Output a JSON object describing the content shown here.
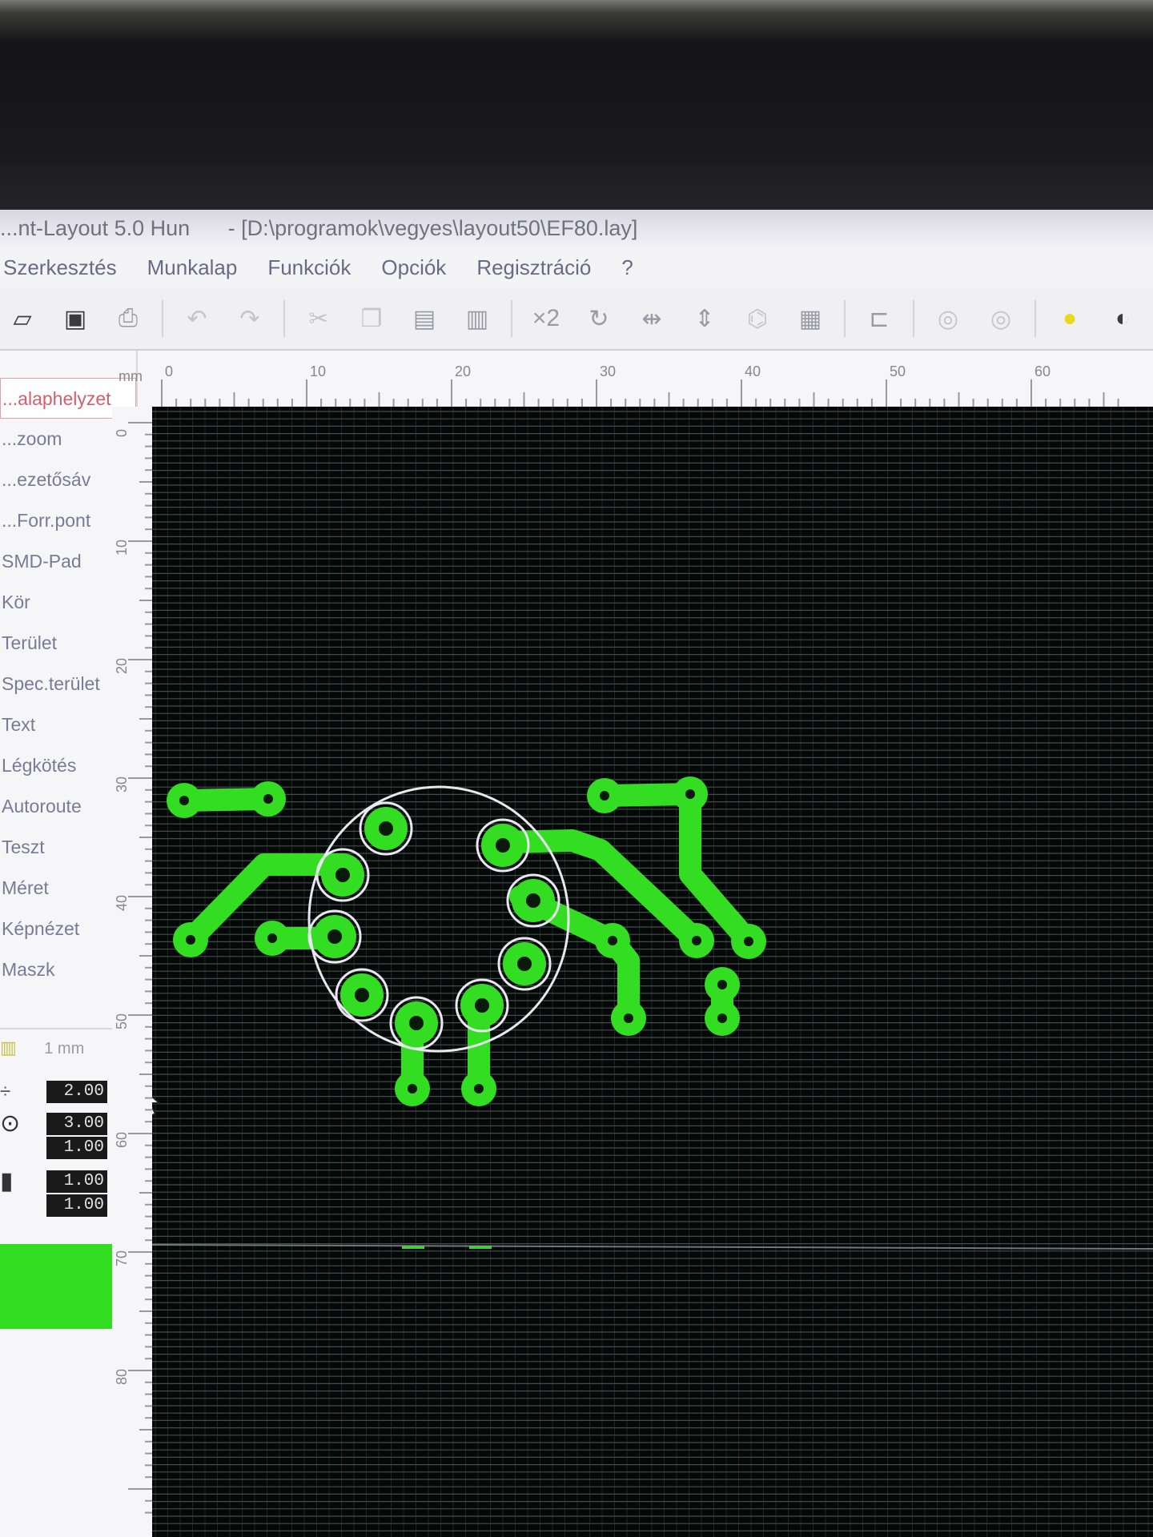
{
  "window": {
    "app_title": "...nt-Layout 5.0 Hun",
    "file_path": "- [D:\\programok\\vegyes\\layout50\\EF80.lay]"
  },
  "menu": [
    "Szerkesztés",
    "Munkalap",
    "Funkciók",
    "Opciók",
    "Regisztráció",
    "?"
  ],
  "toolbar": {
    "buttons": [
      {
        "icon": "open-folder-icon"
      },
      {
        "icon": "save-icon"
      },
      {
        "icon": "print-icon"
      },
      {
        "icon": "undo-icon"
      },
      {
        "icon": "redo-icon"
      },
      {
        "icon": "cut-icon"
      },
      {
        "icon": "copy-icon"
      },
      {
        "icon": "paste-icon"
      },
      {
        "icon": "delete-icon"
      },
      {
        "icon": "duplicate-x2-icon",
        "label": "×2"
      },
      {
        "icon": "rotate-icon"
      },
      {
        "icon": "mirror-horizontal-icon"
      },
      {
        "icon": "mirror-vertical-icon"
      },
      {
        "icon": "group-icon"
      },
      {
        "icon": "grid-icon"
      },
      {
        "icon": "connection-icon"
      },
      {
        "icon": "zoom-icon"
      }
    ]
  },
  "sidebar": {
    "items": [
      {
        "label": "...alaphelyzet",
        "icon": "cursor-icon",
        "active": true
      },
      {
        "label": "...zoom",
        "icon": "zoom-icon"
      },
      {
        "label": "...ezetősáv",
        "icon": "track-icon"
      },
      {
        "label": "...Forr.pont",
        "icon": "solder-pad-icon"
      },
      {
        "label": "SMD-Pad",
        "icon": "smd-pad-icon"
      },
      {
        "label": "Kör",
        "icon": "circle-icon"
      },
      {
        "label": "Terület",
        "icon": "area-icon"
      },
      {
        "label": "Spec.terület",
        "icon": "special-area-icon"
      },
      {
        "label": "Text",
        "icon": "text-icon"
      },
      {
        "label": "Légkötés",
        "icon": "airwire-icon"
      },
      {
        "label": "Autoroute",
        "icon": "autoroute-icon"
      },
      {
        "label": "Teszt",
        "icon": "test-icon"
      },
      {
        "label": "Méret",
        "icon": "measure-icon"
      },
      {
        "label": "Képnézet",
        "icon": "image-view-icon"
      },
      {
        "label": "Maszk",
        "icon": "mask-icon"
      }
    ],
    "grid_label": "1 mm",
    "values": {
      "track_width": "2.00",
      "pad_outer": "3.00",
      "pad_inner": "1.00",
      "smd_w": "1.00",
      "smd_h": "1.00"
    },
    "layer_color": "#33dd22"
  },
  "ruler": {
    "unit": "mm",
    "top_labels": [
      "0",
      "10",
      "20",
      "30",
      "40",
      "50",
      "60"
    ],
    "left_labels": [
      "0",
      "10",
      "20",
      "30",
      "40",
      "50",
      "60",
      "70",
      "80"
    ]
  },
  "board": {
    "copper_color": "#33dd22",
    "silkscreen_color": "#e8e8f0",
    "background": "#040806"
  }
}
